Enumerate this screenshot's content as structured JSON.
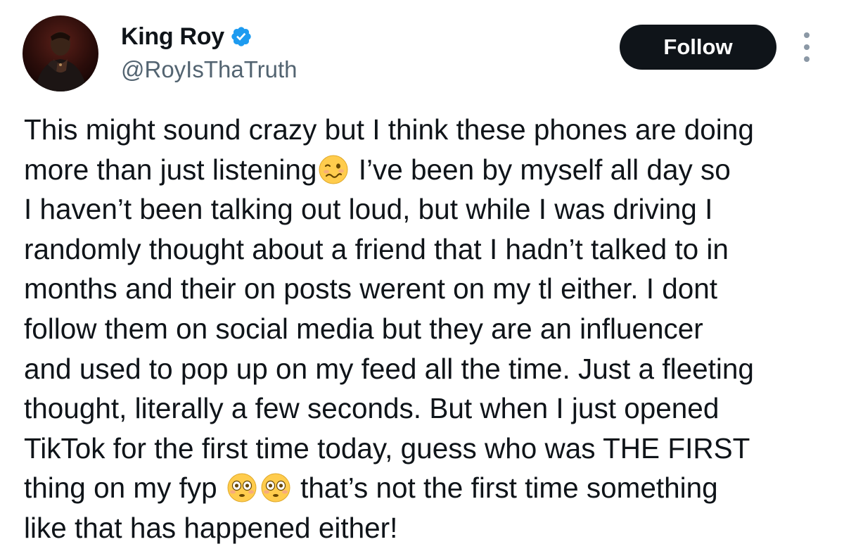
{
  "author": {
    "display_name": "King Roy",
    "handle": "@RoyIsThaTruth",
    "avatar_icon": "avatar-photo",
    "verified_icon": "verified-badge-icon",
    "verified_color": "#1d9bf0"
  },
  "actions": {
    "follow_label": "Follow",
    "more_icon": "more-options-icon"
  },
  "tweet": {
    "lines": [
      "This might sound crazy but I think these phones are doing",
      "more than just listening",
      " I’ve been by myself all day so",
      "I haven’t been talking out loud, but while I was driving I",
      "randomly thought about a friend that I hadn’t talked to in",
      "months and their on posts werent on my tl either. I dont",
      "follow them on social media but they are an influencer",
      "and used to pop up on my feed all the time. Just a fleeting",
      "thought, literally a few seconds. But when I just opened",
      "TikTok for the first time today, guess who was THE FIRST",
      "thing on my fyp",
      " that’s not the first time something",
      "like that has happened either!"
    ],
    "emojis": [
      "woozy-face-emoji",
      "flushed-face-emoji",
      "flushed-face-emoji"
    ]
  },
  "colors": {
    "text": "#0f1419",
    "secondary_text": "#536471",
    "button_bg": "#0f1419",
    "button_text": "#ffffff"
  }
}
